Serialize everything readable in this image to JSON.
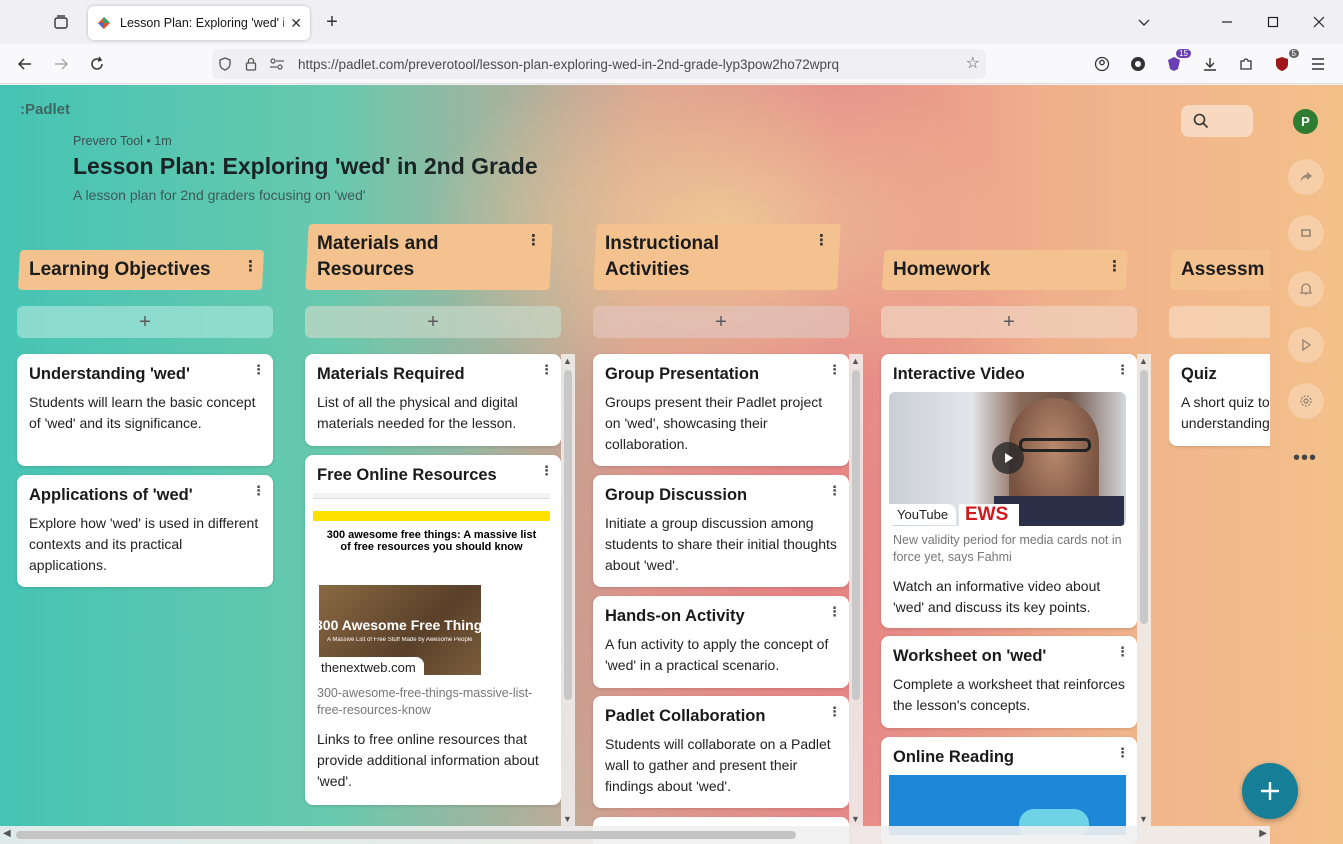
{
  "browser": {
    "tab_title": "Lesson Plan: Exploring 'wed' in",
    "url": "https://padlet.com/preverotool/lesson-plan-exploring-wed-in-2nd-grade-lyp3pow2ho72wprq",
    "extension_badge_1": "15",
    "extension_badge_2": "5"
  },
  "padlet": {
    "logo": ":Padlet",
    "author_meta": "Prevero Tool • 1m",
    "title": "Lesson Plan: Exploring 'wed' in 2nd Grade",
    "subtitle": "A lesson plan for 2nd graders focusing on 'wed'",
    "avatar_initial": "P"
  },
  "columns": {
    "c1": {
      "title": "Learning Objectives"
    },
    "c2": {
      "title_line1": "Materials and",
      "title_line2": "Resources"
    },
    "c3": {
      "title_line1": "Instructional",
      "title_line2": "Activities"
    },
    "c4": {
      "title": "Homework"
    },
    "c5": {
      "title": "Assessm"
    }
  },
  "cards": {
    "lo1": {
      "title": "Understanding 'wed'",
      "body": "Students will learn the basic concept of 'wed' and its significance."
    },
    "lo2": {
      "title": "Applications of 'wed'",
      "body": "Explore how 'wed' is used in different contexts and its practical applications."
    },
    "mr1": {
      "title": "Materials Required",
      "body": "List of all the physical and digital materials needed for the lesson."
    },
    "mr2": {
      "title": "Free Online Resources",
      "preview_headline": "300 awesome free things: A massive list of free resources you should know",
      "preview_overlay": "300 Awesome Free Thing",
      "preview_overlay_sub": "A Massive List of Free Stuff Made by Awesome People",
      "source": "thenextweb.com",
      "caption": "300-awesome-free-things-massive-list-free-resources-know",
      "body": "Links to free online resources that provide additional information about 'wed'."
    },
    "ia1": {
      "title": "Group Presentation",
      "body": "Groups present their Padlet project on 'wed', showcasing their collaboration."
    },
    "ia2": {
      "title": "Group Discussion",
      "body": "Initiate a group discussion among students to share their initial thoughts about 'wed'."
    },
    "ia3": {
      "title": "Hands-on Activity",
      "body": "A fun activity to apply the concept of 'wed' in a practical scenario."
    },
    "ia4": {
      "title": "Padlet Collaboration",
      "body": "Students will collaborate on a Padlet wall to gather and present their findings about 'wed'."
    },
    "hw1": {
      "title": "Interactive Video",
      "source": "YouTube",
      "news_text": "EWS",
      "caption": "New validity period for media cards not in force yet, says Fahmi",
      "body": "Watch an informative video about 'wed' and discuss its key points."
    },
    "hw2": {
      "title": "Worksheet on 'wed'",
      "body": "Complete a worksheet that reinforces the lesson's concepts."
    },
    "hw3": {
      "title": "Online Reading"
    },
    "as1": {
      "title": "Quiz",
      "body": "A short quiz to test the student's understanding"
    }
  },
  "colors": {
    "header": "#f3c28e",
    "fab": "#167e97"
  }
}
